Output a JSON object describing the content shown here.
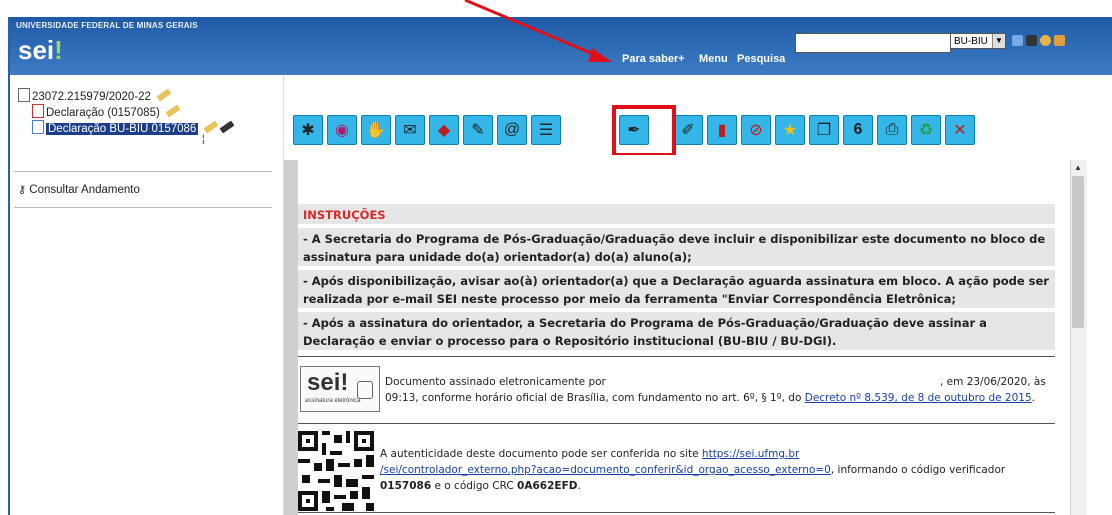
{
  "header": {
    "university": "UNIVERSIDADE FEDERAL DE MINAS GERAIS",
    "logo": "sei",
    "logo_mark": "!",
    "nav_para_saber": "Para saber+",
    "nav_menu": "Menu",
    "nav_pesquisa": "Pesquisa",
    "search_value": "",
    "unit_selected": "BU-BIU"
  },
  "tree": {
    "process": "23072.215979/2020-22",
    "doc1": "Declaração (0157085)",
    "doc2": "Declaração BU-BIU 0157086",
    "cursor": "¦",
    "consult": "Consultar Andamento"
  },
  "toolbar": {
    "icons": [
      "incluir-documento-icon",
      "acompanhamento-icon",
      "ciencia-icon",
      "enviar-processo-icon",
      "atualizar-andamento-icon",
      "atribuir-icon",
      "enviar-email-icon",
      "incluir-bloco-icon",
      "assinar-documento-icon",
      "alterar-documento-icon",
      "gerenciar-marcador-icon",
      "cancelar-documento-icon",
      "favoritos-icon",
      "copiar-icon",
      "numero-6-icon",
      "imprimir-icon",
      "gravar-icon",
      "excluir-icon"
    ],
    "colors": {
      "accent": "#0f7fb0",
      "highlight": "#e0101a"
    }
  },
  "document": {
    "instructions_title": "INSTRUÇÕES",
    "instructions": [
      "- A Secretaria do Programa de Pós-Graduação/Graduação deve incluir e disponibilizar este documento no bloco de assinatura para unidade do(a) orientador(a) do(a) aluno(a);",
      "- Após disponibilização, avisar ao(à) orientador(a) que a Declaração aguarda assinatura em bloco. A ação pode ser realizada por e-mail SEI neste processo por meio da ferramenta \"Enviar Correspondência Eletrônica;",
      "- Após a assinatura do orientador, a Secretaria do Programa de Pós-Graduação/Graduação deve assinar a Declaração e enviar o processo para o Repositório institucional (BU-BIU / BU-DGI)."
    ],
    "seal_text": "sei!",
    "seal_caption": "assinatura eletrônica",
    "signature_prefix": "Documento assinado eletronicamente por",
    "signature_date": ", em 23/06/2020, às",
    "signature_line2": "09:13, conforme horário oficial de Brasília, com fundamento no art. 6º, § 1º, do",
    "signature_decree": "Decreto nº 8.539, de 8 de outubro de 2015",
    "signature_end": ".",
    "auth_prefix": "A autenticidade deste documento pode ser conferida no site",
    "auth_link1": "https://sei.ufmg.br",
    "auth_link2": "/sei/controlador_externo.php?acao=documento_conferir&id_orgao_acesso_externo=0",
    "auth_mid": ", informando o código verificador",
    "auth_code": "0157086",
    "auth_crc_prefix": "e o código CRC",
    "auth_crc": "0A662EFD",
    "auth_end": "."
  }
}
